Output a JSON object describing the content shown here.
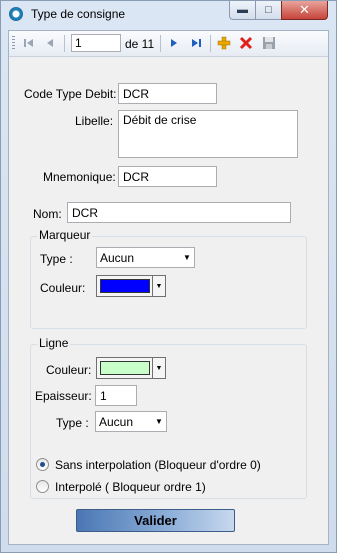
{
  "window": {
    "title": "Type de consigne"
  },
  "toolbar": {
    "position": "1",
    "of_label": "de 11",
    "icons": [
      "first-record-icon",
      "previous-record-icon",
      "next-record-icon",
      "last-record-icon",
      "add-icon",
      "delete-icon",
      "save-icon"
    ]
  },
  "form": {
    "code_label": "Code Type Debit:",
    "code_value": "DCR",
    "libelle_label": "Libelle:",
    "libelle_value": "Débit de crise",
    "mnemonique_label": "Mnemonique:",
    "mnemonique_value": "DCR",
    "nom_label": "Nom:",
    "nom_value": "DCR"
  },
  "marqueur": {
    "title": "Marqueur",
    "type_label": "Type :",
    "type_value": "Aucun",
    "couleur_label": "Couleur:",
    "couleur_color": "#0000ff"
  },
  "ligne": {
    "title": "Ligne",
    "couleur_label": "Couleur:",
    "couleur_color": "#c8ffc8",
    "epaisseur_label": "Epaisseur:",
    "epaisseur_value": "1",
    "type_label": "Type :",
    "type_value": "Aucun",
    "radio_options": [
      {
        "label": "Sans interpolation (Bloqueur d'ordre 0)",
        "selected": true
      },
      {
        "label": "Interpolé ( Bloqueur ordre 1)",
        "selected": false
      }
    ]
  },
  "actions": {
    "validate_label": "Valider"
  }
}
